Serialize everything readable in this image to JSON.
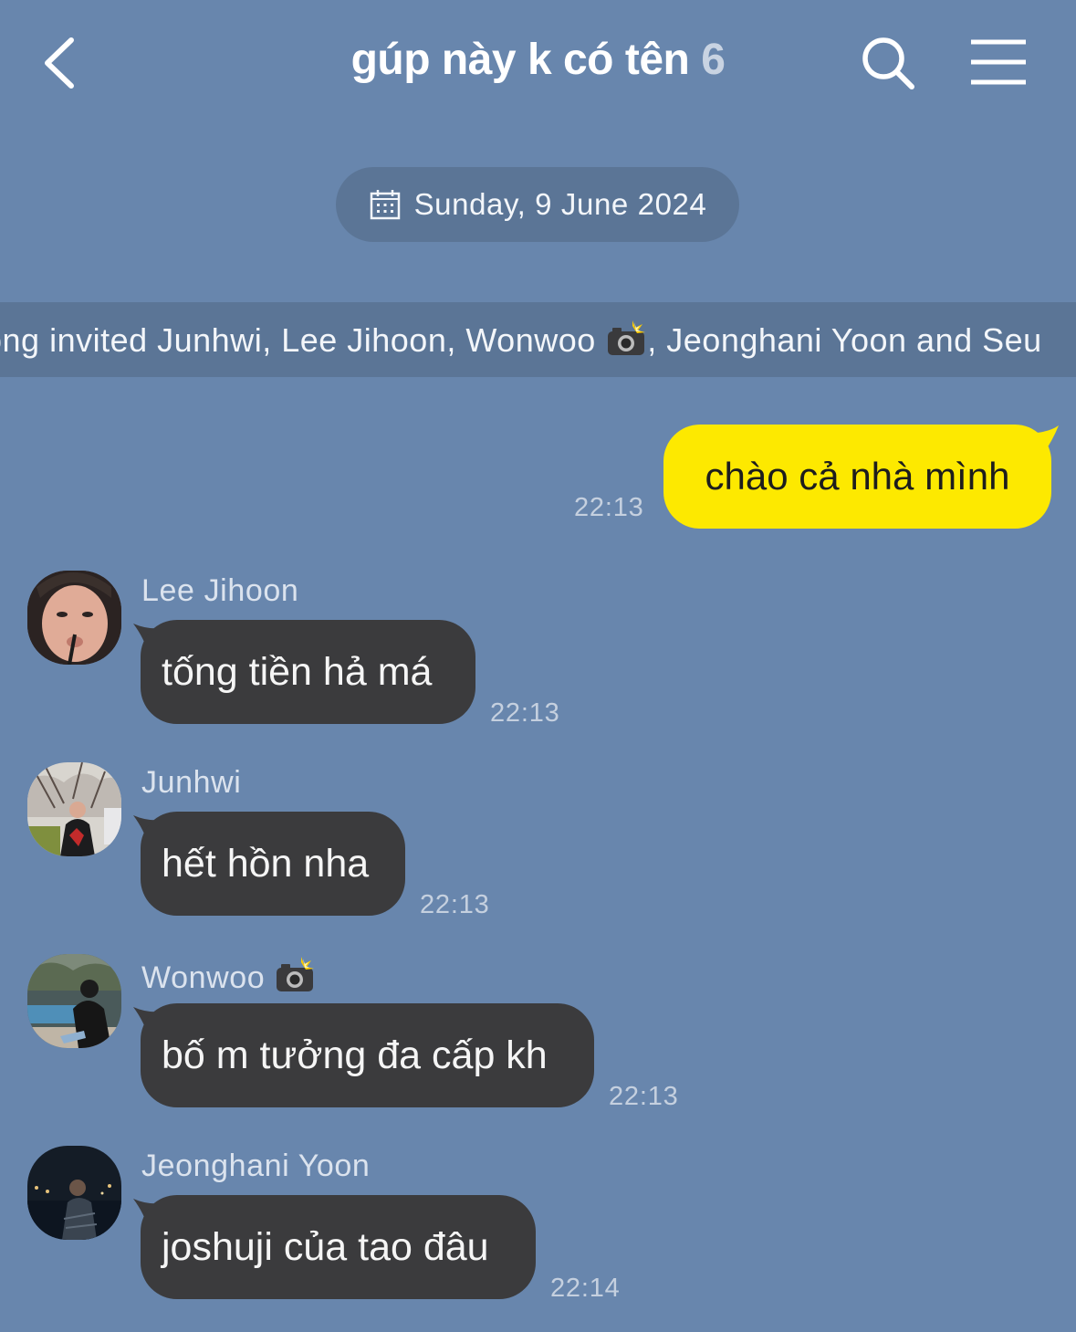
{
  "header": {
    "title": "gúp này k có tên",
    "member_count": "6"
  },
  "date_divider": "Sunday, 9 June 2024",
  "system_message": {
    "text_before": "ong invited Junhwi, Lee Jihoon, Wonwoo ",
    "text_after": ", Jeonghani Yoon and Seu"
  },
  "messages": [
    {
      "sender": "me",
      "text": "chào cả nhà mình",
      "time": "22:13"
    },
    {
      "sender": "Lee Jihoon",
      "text": "tống tiền hả má",
      "time": "22:13"
    },
    {
      "sender": "Junhwi",
      "text": "hết hồn nha",
      "time": "22:13"
    },
    {
      "sender": "Wonwoo",
      "text": "bố m tưởng đa cấp kh",
      "time": "22:13"
    },
    {
      "sender": "Jeonghani Yoon",
      "text": "joshuji của tao đâu",
      "time": "22:14"
    }
  ],
  "colors": {
    "background": "#6886ad",
    "my_bubble": "#fde900",
    "other_bubble": "#3b3b3d"
  },
  "icons": {
    "back": "chevron-left-icon",
    "search": "search-icon",
    "menu": "hamburger-menu-icon",
    "calendar": "calendar-icon",
    "camera_flash": "camera-flash-emoji"
  }
}
